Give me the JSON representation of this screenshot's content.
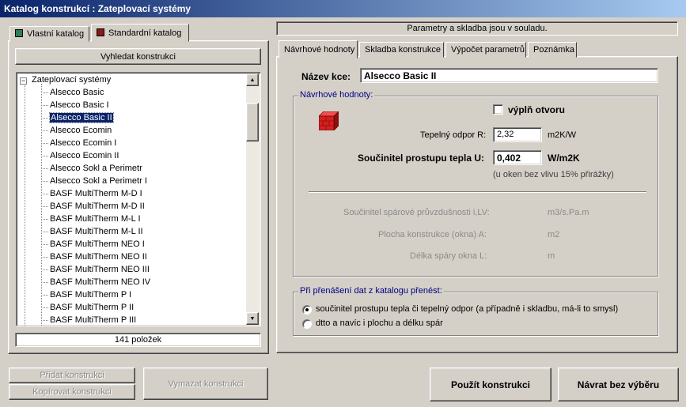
{
  "window": {
    "title": "Katalog konstrukcí : Zateplovací systémy"
  },
  "left_tabs": [
    {
      "label": "Vlastní katalog",
      "icon": "table-icon"
    },
    {
      "label": "Standardní katalog",
      "icon": "book-icon"
    }
  ],
  "search_button": "Vyhledat konstrukci",
  "tree": {
    "root": "Zateplovací systémy",
    "items": [
      "Alsecco Basic",
      "Alsecco Basic I",
      "Alsecco Basic II",
      "Alsecco Ecomin",
      "Alsecco Ecomin I",
      "Alsecco Ecomin II",
      "Alsecco Sokl a Perimetr",
      "Alsecco Sokl a Perimetr I",
      "BASF MultiTherm M-D I",
      "BASF MultiTherm M-D II",
      "BASF MultiTherm M-L I",
      "BASF MultiTherm M-L II",
      "BASF MultiTherm NEO I",
      "BASF MultiTherm NEO II",
      "BASF MultiTherm NEO III",
      "BASF MultiTherm NEO IV",
      "BASF MultiTherm P I",
      "BASF MultiTherm P II",
      "BASF MultiTherm P III"
    ],
    "selected_index": 2
  },
  "count_label": "141 položek",
  "status_message": "Parametry a skladba jsou v souladu.",
  "right_tabs": [
    "Návrhové hodnoty",
    "Skladba konstrukce",
    "Výpočet parametrů",
    "Poznámka"
  ],
  "form": {
    "name_label": "Název kce:",
    "name_value": "Alsecco Basic II",
    "group_title": "Návrhové hodnoty:",
    "checkbox_label": "výplň otvoru",
    "resistance_label": "Tepelný odpor  R:",
    "resistance_value": "2,32",
    "resistance_unit": "m2K/W",
    "u_label": "Součinitel prostupu tepla  U:",
    "u_value": "0,402",
    "u_unit": "W/m2K",
    "u_note": "(u oken bez vlivu 15% přirážky)",
    "joint_label": "Součinitel spárové průvzdušnosti  i,LV:",
    "joint_unit": "m3/s.Pa.m",
    "area_label": "Plocha konstrukce (okna)  A:",
    "area_unit": "m2",
    "length_label": "Délka spáry okna  L:",
    "length_unit": "m"
  },
  "transfer": {
    "title": "Při přenášení dat z katalogu přenést:",
    "options": [
      "součinitel prostupu tepla či tepelný odpor (a případně i skladbu, má-li to smysl)",
      "dtto a navíc i plochu a délku spár"
    ],
    "selected": 0
  },
  "buttons": {
    "add": "Přidat konstrukci",
    "copy": "Kopírovat konstrukci",
    "delete": "Vymazat konstrukci",
    "use": "Použít konstrukci",
    "back": "Návrat bez výběru"
  },
  "colors": {
    "title_start": "#0a246a",
    "title_end": "#a6caf0",
    "accent": "#000080",
    "brick": "#d42020"
  }
}
